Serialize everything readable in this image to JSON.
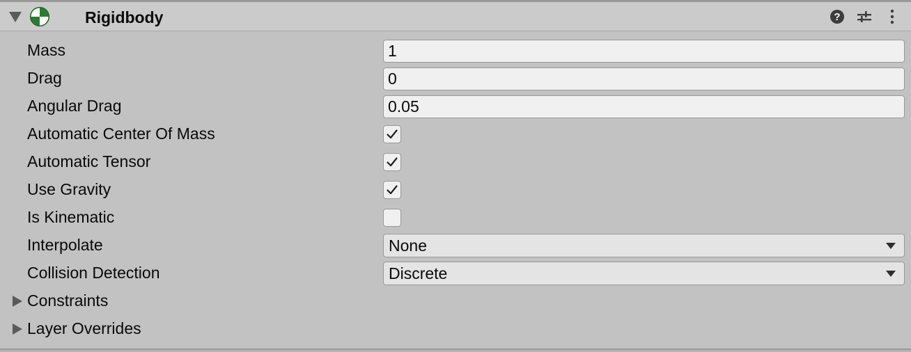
{
  "component": {
    "title": "Rigidbody",
    "icon": "rigidbody-icon",
    "expanded": true,
    "header_icons": [
      "help-icon",
      "presets-icon",
      "context-menu-icon"
    ]
  },
  "fields": {
    "mass": {
      "label": "Mass",
      "value": "1"
    },
    "drag": {
      "label": "Drag",
      "value": "0"
    },
    "angular_drag": {
      "label": "Angular Drag",
      "value": "0.05"
    },
    "automatic_center_of_mass": {
      "label": "Automatic Center Of Mass",
      "checked": true
    },
    "automatic_tensor": {
      "label": "Automatic Tensor",
      "checked": true
    },
    "use_gravity": {
      "label": "Use Gravity",
      "checked": true
    },
    "is_kinematic": {
      "label": "Is Kinematic",
      "checked": false
    },
    "interpolate": {
      "label": "Interpolate",
      "value": "None"
    },
    "collision_detection": {
      "label": "Collision Detection",
      "value": "Discrete"
    }
  },
  "foldouts": {
    "constraints": {
      "label": "Constraints",
      "expanded": false
    },
    "layer_overrides": {
      "label": "Layer Overrides",
      "expanded": false
    }
  },
  "colors": {
    "panel_bg": "#c2c2c2",
    "header_bg": "#cbcbcb",
    "field_bg": "#f0f0f0",
    "dropdown_bg": "#e4e4e4",
    "icon_green": "#2d7a35"
  }
}
